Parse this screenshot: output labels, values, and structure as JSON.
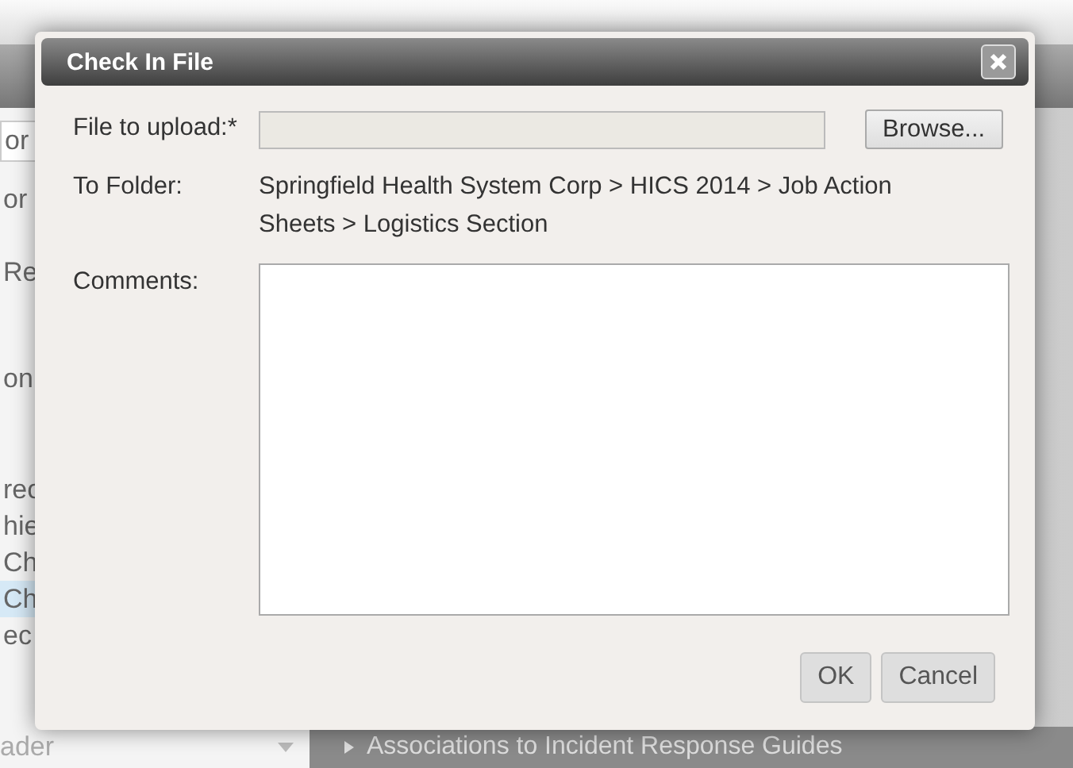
{
  "background_page": {
    "left_fragments": [
      {
        "text": "or",
        "kind": "field",
        "selected": false
      },
      {
        "text": "or",
        "kind": "text",
        "selected": false
      },
      {
        "text": "Re",
        "kind": "text",
        "selected": false
      },
      {
        "text": "on",
        "kind": "text",
        "selected": false
      },
      {
        "text": "rec",
        "kind": "text",
        "selected": false
      },
      {
        "text": "hie",
        "kind": "text",
        "selected": false
      },
      {
        "text": "Ch",
        "kind": "text",
        "selected": false
      },
      {
        "text": "Ch",
        "kind": "text",
        "selected": true
      },
      {
        "text": "ec",
        "kind": "text",
        "selected": false
      }
    ],
    "selector": {
      "value": "ader"
    },
    "tree_item": {
      "label": "Associations to Incident Response Guides",
      "expanded": false
    }
  },
  "dialog": {
    "title": "Check In File",
    "file_field": {
      "label": "File to upload:*",
      "button": "Browse..."
    },
    "folder": {
      "label": "To Folder:",
      "value": "Springfield Health System Corp > HICS 2014 > Job Action Sheets > Logistics Section"
    },
    "comments": {
      "label": "Comments:"
    },
    "buttons": [
      "OK",
      "Cancel"
    ]
  }
}
